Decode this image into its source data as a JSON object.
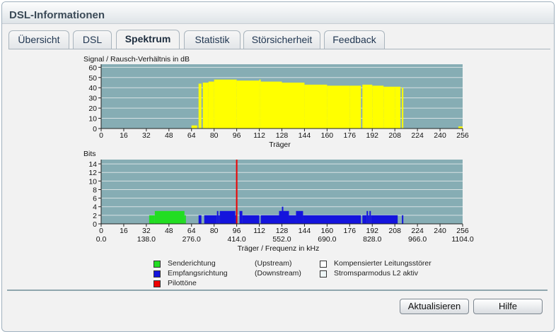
{
  "window": {
    "title": "DSL-Informationen"
  },
  "tabs": [
    "Übersicht",
    "DSL",
    "Spektrum",
    "Statistik",
    "Störsicherheit",
    "Feedback"
  ],
  "active_tab": "Spektrum",
  "colors": {
    "plot_bg": "#86adb4",
    "grid": "#d7e2e4",
    "snr": "#ffff00",
    "upstream": "#22dd22",
    "downstream": "#1414dd",
    "pilot": "#ee0000"
  },
  "chart_data": [
    {
      "type": "bar",
      "title": "Signal / Rausch-Verhältnis in dB",
      "xlabel": "Träger",
      "ylabel": "Signal / Rausch-Verhältnis in dB",
      "ylim": [
        0,
        63
      ],
      "xlim": [
        0,
        256
      ],
      "y_ticks": [
        0,
        10,
        20,
        30,
        40,
        50,
        60
      ],
      "x_ticks": [
        0,
        16,
        32,
        48,
        64,
        80,
        96,
        112,
        128,
        144,
        160,
        176,
        192,
        208,
        224,
        240,
        256
      ],
      "series": [
        {
          "color": "snr",
          "segments": [
            {
              "from": 64,
              "to": 68,
              "value": 3
            },
            {
              "from": 69,
              "to": 70,
              "value": 44
            },
            {
              "from": 70,
              "to": 71,
              "value": 44
            },
            {
              "from": 72,
              "to": 76,
              "value": 45
            },
            {
              "from": 76,
              "to": 80,
              "value": 46
            },
            {
              "from": 80,
              "to": 96,
              "value": 48
            },
            {
              "from": 96,
              "to": 112,
              "value": 47
            },
            {
              "from": 112,
              "to": 113,
              "value": 48
            },
            {
              "from": 113,
              "to": 128,
              "value": 46
            },
            {
              "from": 128,
              "to": 144,
              "value": 45
            },
            {
              "from": 144,
              "to": 160,
              "value": 43
            },
            {
              "from": 160,
              "to": 176,
              "value": 42
            },
            {
              "from": 176,
              "to": 184,
              "value": 42
            },
            {
              "from": 185,
              "to": 192,
              "value": 43
            },
            {
              "from": 192,
              "to": 200,
              "value": 42
            },
            {
              "from": 200,
              "to": 208,
              "value": 41
            },
            {
              "from": 208,
              "to": 212,
              "value": 41
            },
            {
              "from": 213,
              "to": 214,
              "value": 40
            },
            {
              "from": 253,
              "to": 256,
              "value": 2
            }
          ]
        }
      ]
    },
    {
      "type": "bar",
      "title": "Bits",
      "xlabel": "Träger / Frequenz in kHz",
      "ylabel": "Bits",
      "ylim": [
        0,
        15
      ],
      "xlim": [
        0,
        256
      ],
      "y_ticks": [
        0,
        2,
        4,
        6,
        8,
        10,
        12,
        14
      ],
      "x_ticks": [
        0,
        16,
        32,
        48,
        64,
        80,
        96,
        112,
        128,
        144,
        160,
        176,
        192,
        208,
        224,
        240,
        256
      ],
      "x_ticks_khz": [
        "0.0",
        "138.0",
        "276.0",
        "414.0",
        "552.0",
        "690.0",
        "828.0",
        "966.0",
        "1104.0"
      ],
      "series": [
        {
          "name": "Senderichtung",
          "color": "upstream",
          "segments": [
            {
              "from": 34,
              "to": 38,
              "value": 2
            },
            {
              "from": 38,
              "to": 59,
              "value": 3
            },
            {
              "from": 59,
              "to": 60,
              "value": 2
            }
          ]
        },
        {
          "name": "Empfangsrichtung",
          "color": "downstream",
          "segments": [
            {
              "from": 69,
              "to": 71,
              "value": 2
            },
            {
              "from": 73,
              "to": 82,
              "value": 2
            },
            {
              "from": 82,
              "to": 83,
              "value": 3
            },
            {
              "from": 83,
              "to": 84,
              "value": 2
            },
            {
              "from": 84,
              "to": 95,
              "value": 3
            },
            {
              "from": 95,
              "to": 96,
              "value": 2
            },
            {
              "from": 98,
              "to": 100,
              "value": 3
            },
            {
              "from": 100,
              "to": 112,
              "value": 2
            },
            {
              "from": 113,
              "to": 126,
              "value": 2
            },
            {
              "from": 126,
              "to": 128,
              "value": 3
            },
            {
              "from": 128,
              "to": 129,
              "value": 4
            },
            {
              "from": 129,
              "to": 133,
              "value": 3
            },
            {
              "from": 133,
              "to": 138,
              "value": 2
            },
            {
              "from": 138,
              "to": 143,
              "value": 3
            },
            {
              "from": 143,
              "to": 184,
              "value": 2
            },
            {
              "from": 185,
              "to": 188,
              "value": 2
            },
            {
              "from": 188,
              "to": 189,
              "value": 3
            },
            {
              "from": 189,
              "to": 190,
              "value": 2
            },
            {
              "from": 190,
              "to": 191,
              "value": 3
            },
            {
              "from": 191,
              "to": 210,
              "value": 2
            },
            {
              "from": 213,
              "to": 214,
              "value": 2
            }
          ]
        },
        {
          "name": "Pilottöne",
          "color": "pilot",
          "markers": [
            96
          ]
        }
      ]
    }
  ],
  "legend": [
    {
      "label": "Senderichtung",
      "direction": "(Upstream)",
      "color": "upstream"
    },
    {
      "label": "Empfangsrichtung",
      "direction": "(Downstream)",
      "color": "downstream"
    },
    {
      "label": "Pilottöne",
      "direction": "",
      "color": "pilot"
    },
    {
      "label": "Kompensierter Leitungsstörer",
      "direction": "",
      "color": "#ffffff"
    },
    {
      "label": "Stromsparmodus L2 aktiv",
      "direction": "",
      "color": "#eef6f7"
    }
  ],
  "buttons": {
    "refresh": "Aktualisieren",
    "help": "Hilfe"
  }
}
